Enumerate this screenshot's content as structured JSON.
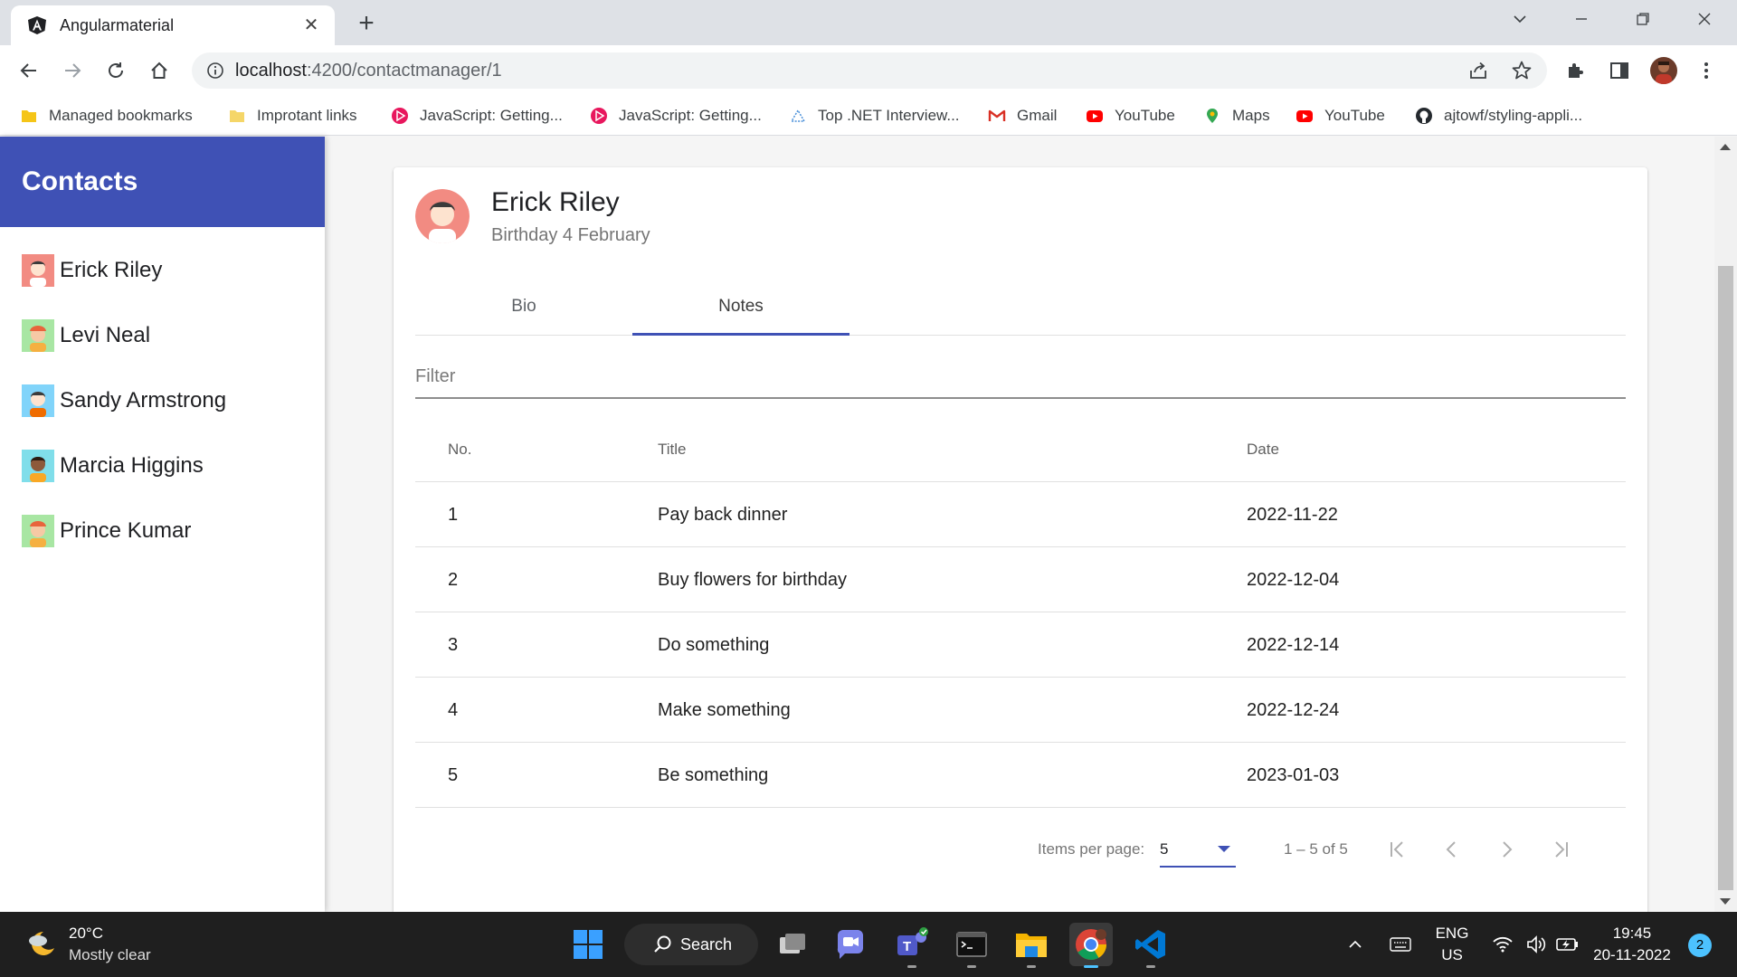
{
  "browser": {
    "tab_title": "Angularmaterial",
    "url_host": "localhost",
    "url_path": ":4200/contactmanager/1",
    "bookmarks": [
      {
        "label": "Managed bookmarks",
        "icon": "folder-icon"
      },
      {
        "label": "Improtant links",
        "icon": "folder-icon"
      },
      {
        "label": "JavaScript: Getting...",
        "icon": "pluralsight-icon"
      },
      {
        "label": "JavaScript: Getting...",
        "icon": "pluralsight-icon"
      },
      {
        "label": "Top .NET Interview...",
        "icon": "site-icon"
      },
      {
        "label": "Gmail",
        "icon": "gmail-icon"
      },
      {
        "label": "YouTube",
        "icon": "youtube-icon"
      },
      {
        "label": "Maps",
        "icon": "maps-icon"
      },
      {
        "label": "YouTube",
        "icon": "youtube-icon"
      },
      {
        "label": "ajtowf/styling-appli...",
        "icon": "github-icon"
      }
    ]
  },
  "sidenav": {
    "title": "Contacts",
    "contacts": [
      {
        "name": "Erick Riley"
      },
      {
        "name": "Levi Neal"
      },
      {
        "name": "Sandy Armstrong"
      },
      {
        "name": "Marcia Higgins"
      },
      {
        "name": "Prince Kumar"
      }
    ]
  },
  "card": {
    "name": "Erick Riley",
    "birthday": "Birthday 4 February",
    "tabs": [
      "Bio",
      "Notes"
    ],
    "active_tab": "Notes",
    "filter_placeholder": "Filter"
  },
  "table": {
    "headers": {
      "no": "No.",
      "title": "Title",
      "date": "Date"
    },
    "rows": [
      {
        "no": "1",
        "title": "Pay back dinner",
        "date": "2022-11-22"
      },
      {
        "no": "2",
        "title": "Buy flowers for birthday",
        "date": "2022-12-04"
      },
      {
        "no": "3",
        "title": "Do something",
        "date": "2022-12-14"
      },
      {
        "no": "4",
        "title": "Make something",
        "date": "2022-12-24"
      },
      {
        "no": "5",
        "title": "Be something",
        "date": "2023-01-03"
      }
    ]
  },
  "paginator": {
    "label": "Items per page:",
    "page_size": "5",
    "range": "1 – 5 of 5"
  },
  "taskbar": {
    "temperature": "20°C",
    "weather": "Mostly clear",
    "search": "Search",
    "lang": "ENG",
    "region": "US",
    "time": "19:45",
    "date": "20-11-2022",
    "notifications": "2"
  },
  "colors": {
    "primary": "#3f51b5",
    "taskbar": "#1f1f1f"
  }
}
